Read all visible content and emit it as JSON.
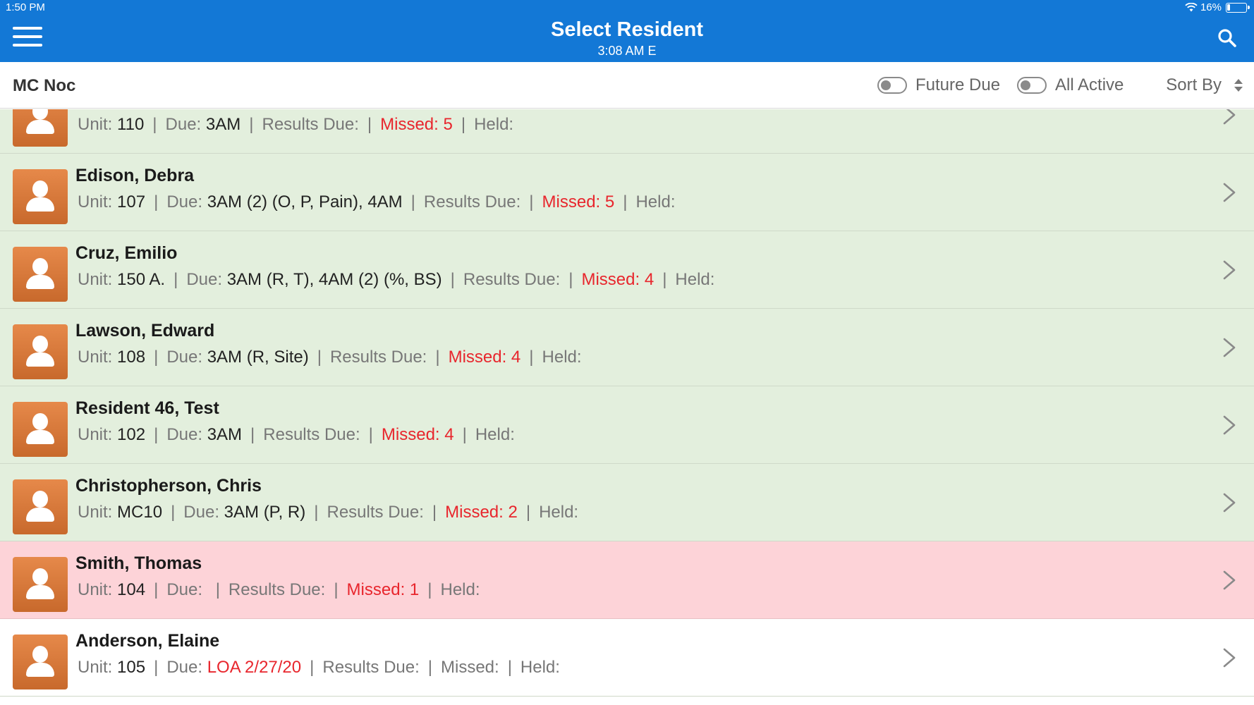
{
  "status_bar": {
    "time": "1:50 PM",
    "battery": "16%"
  },
  "header": {
    "title": "Select Resident",
    "subtitle": "3:08 AM E"
  },
  "toolbar": {
    "unit_name": "MC Noc",
    "future_due_label": "Future Due",
    "all_active_label": "All Active",
    "sort_by_label": "Sort By"
  },
  "labels": {
    "unit": "Unit:",
    "due": "Due:",
    "results_due": "Results Due:",
    "held": "Held:",
    "separator": "|"
  },
  "residents": [
    {
      "name": "",
      "unit": "110",
      "due": "3AM",
      "missed": "Missed: 5",
      "row_color": "green"
    },
    {
      "name": "Edison, Debra",
      "unit": "107",
      "due": "3AM (2) (O, P, Pain), 4AM",
      "missed": "Missed: 5",
      "row_color": "green"
    },
    {
      "name": "Cruz, Emilio",
      "unit": "150 A.",
      "due": "3AM (R, T), 4AM (2) (%, BS)",
      "missed": "Missed: 4",
      "row_color": "green"
    },
    {
      "name": "Lawson, Edward",
      "unit": "108",
      "due": "3AM (R, Site)",
      "missed": "Missed: 4",
      "row_color": "green"
    },
    {
      "name": "Resident 46, Test",
      "unit": "102",
      "due": "3AM",
      "missed": "Missed: 4",
      "row_color": "green"
    },
    {
      "name": "Christopherson, Chris",
      "unit": "MC10",
      "due": "3AM (P, R)",
      "missed": "Missed: 2",
      "row_color": "green"
    },
    {
      "name": "Smith, Thomas",
      "unit": "104",
      "due": "",
      "missed": "Missed: 1",
      "row_color": "pink"
    },
    {
      "name": "Anderson, Elaine",
      "unit": "105",
      "due": "LOA 2/27/20",
      "missed": "Missed:",
      "row_color": "white"
    }
  ],
  "colors": {
    "header_blue": "#1378d6",
    "green_row": "#e3efdd",
    "pink_row": "#fdd3d8",
    "missed_red": "#e8262d",
    "avatar_orange": "#d97b3a"
  },
  "icons": [
    "wifi-icon",
    "battery-icon",
    "menu-icon",
    "search-icon",
    "sort-icon",
    "person-icon",
    "chevron-right-icon"
  ]
}
